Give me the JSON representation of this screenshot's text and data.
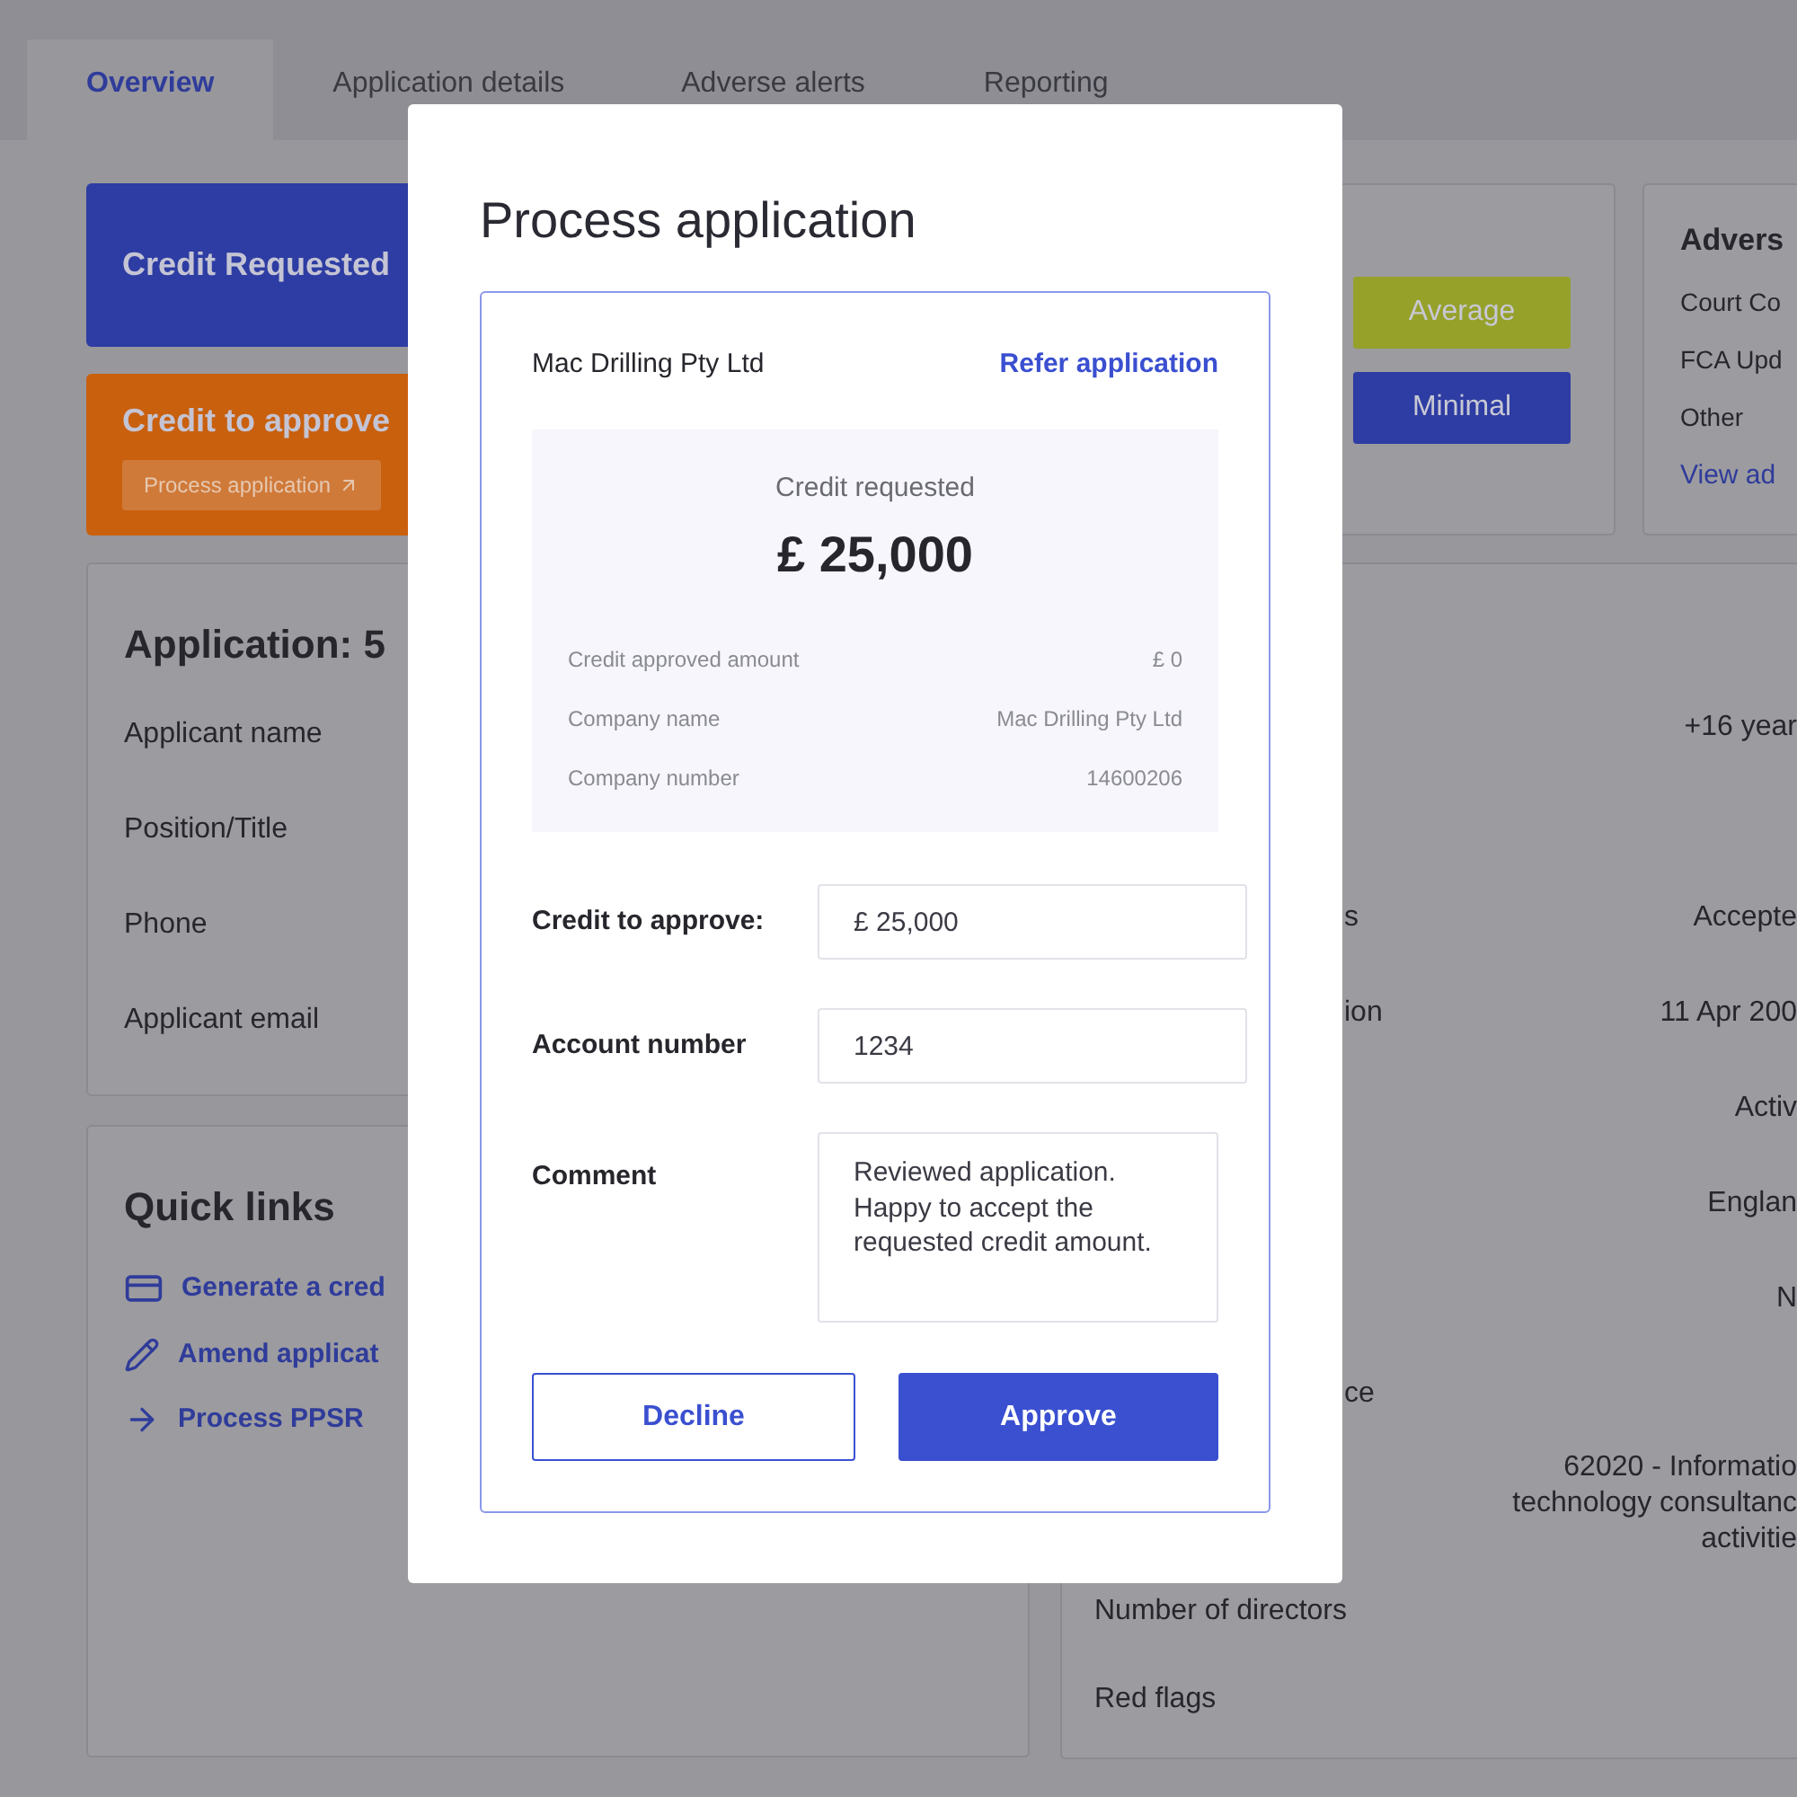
{
  "tabs": [
    {
      "label": "Overview",
      "selected": true
    },
    {
      "label": "Application details",
      "selected": false
    },
    {
      "label": "Adverse alerts",
      "selected": false
    },
    {
      "label": "Reporting",
      "selected": false
    }
  ],
  "summary_cards": [
    {
      "title": "Credit Requested",
      "color": "#2e3da3"
    },
    {
      "title": "Credit to approve",
      "color": "#c9600e",
      "action": "Process application"
    }
  ],
  "risk_badges": [
    {
      "label": "Average",
      "color": "#96a12a"
    },
    {
      "label": "Minimal",
      "color": "#2e3da3"
    }
  ],
  "adverse_card": {
    "title": "Advers",
    "items": [
      "Court Co",
      "FCA Upd",
      "Other"
    ],
    "link": "View ad"
  },
  "application_card": {
    "title": "Application: 5",
    "fields": [
      "Applicant name",
      "Position/Title",
      "Phone",
      "Applicant email"
    ]
  },
  "quick_links": {
    "title": "Quick links",
    "items": [
      {
        "kind": "card",
        "label": "Generate a cred"
      },
      {
        "kind": "pencil",
        "label": "Amend applicat"
      },
      {
        "kind": "arrow",
        "label": "Process PPSR"
      }
    ]
  },
  "company_card": {
    "rows": [
      {
        "value_lines": [
          "+16 year"
        ]
      },
      {
        "label": "s",
        "value_lines": [
          "Accepte"
        ]
      },
      {
        "label": "ion",
        "value_lines": [
          "11 Apr 200"
        ]
      },
      {
        "value_lines": [
          "Activ"
        ]
      },
      {
        "value_lines": [
          "Englan"
        ]
      },
      {
        "value_lines": [
          "N"
        ]
      },
      {
        "label": "ce"
      },
      {
        "value_lines": [
          "62020 - Informatio",
          "technology consultanc",
          "activitie"
        ]
      }
    ],
    "footer_rows": [
      "Number of directors",
      "Red flags"
    ]
  },
  "modal": {
    "title": "Process application",
    "company": "Mac Drilling Pty Ltd",
    "refer_link": "Refer application",
    "summary": {
      "caption": "Credit requested",
      "amount": "£ 25,000",
      "rows": [
        {
          "label": "Credit approved amount",
          "value": "£ 0"
        },
        {
          "label": "Company name",
          "value": "Mac Drilling Pty Ltd"
        },
        {
          "label": "Company number",
          "value": "14600206"
        }
      ]
    },
    "fields": [
      {
        "kind": "input",
        "label": "Credit to approve:",
        "value": "£ 25,000"
      },
      {
        "kind": "input",
        "label": "Account number",
        "value": "1234"
      },
      {
        "kind": "textarea",
        "label": "Comment",
        "value": "Reviewed application. Happy to accept the requested credit amount."
      }
    ],
    "buttons": [
      {
        "label": "Decline",
        "kind": "secondary"
      },
      {
        "label": "Approve",
        "kind": "primary"
      }
    ]
  }
}
